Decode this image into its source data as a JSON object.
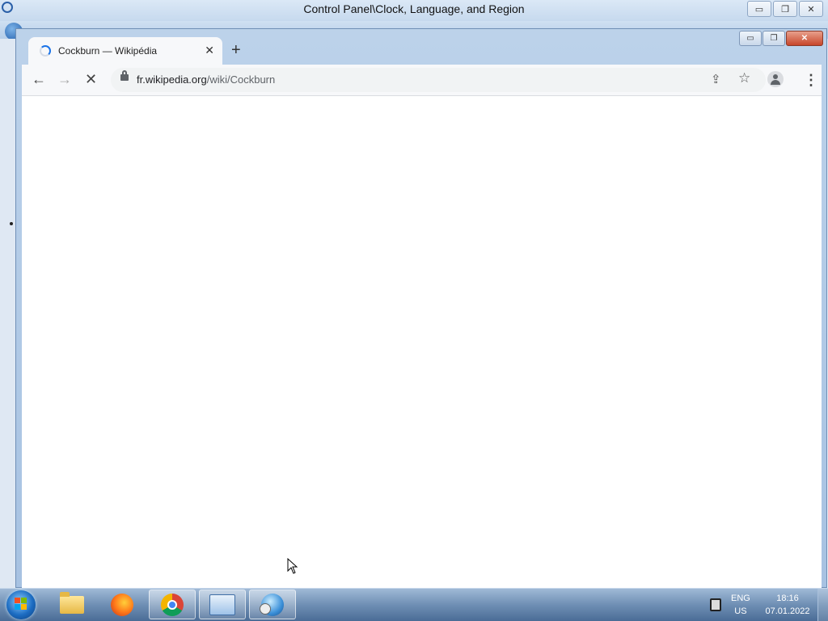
{
  "control_panel": {
    "title": "Control Panel\\Clock, Language, and Region",
    "minimize": "▭",
    "restore": "❐",
    "close": "✕"
  },
  "browser": {
    "window_controls": {
      "minimize": "▭",
      "restore": "❐",
      "close": "✕"
    },
    "tab": {
      "title": "Cockburn — Wikipédia",
      "close": "✕",
      "loading": true
    },
    "new_tab": "+",
    "toolbar": {
      "back": "←",
      "forward": "→",
      "stop": "✕",
      "url_host": "fr.wikipedia.org",
      "url_path": "/wiki/Cockburn",
      "share": "⇪",
      "bookmark": "☆",
      "menu": "⋮"
    }
  },
  "taskbar": {
    "apps": [
      {
        "name": "Windows Explorer",
        "icon": "folder-icon"
      },
      {
        "name": "Firefox",
        "icon": "firefox-icon"
      },
      {
        "name": "Google Chrome",
        "icon": "chrome-icon",
        "active": true
      },
      {
        "name": "Control Panel",
        "icon": "control-panel-icon"
      },
      {
        "name": "Date and Time",
        "icon": "globe-clock-icon"
      }
    ],
    "language_line1": "ENG",
    "language_line2": "US",
    "time": "18:16",
    "date": "07.01.2022"
  },
  "colors": {
    "accent": "#1a73e8",
    "taskbar": "#4a6c96"
  }
}
